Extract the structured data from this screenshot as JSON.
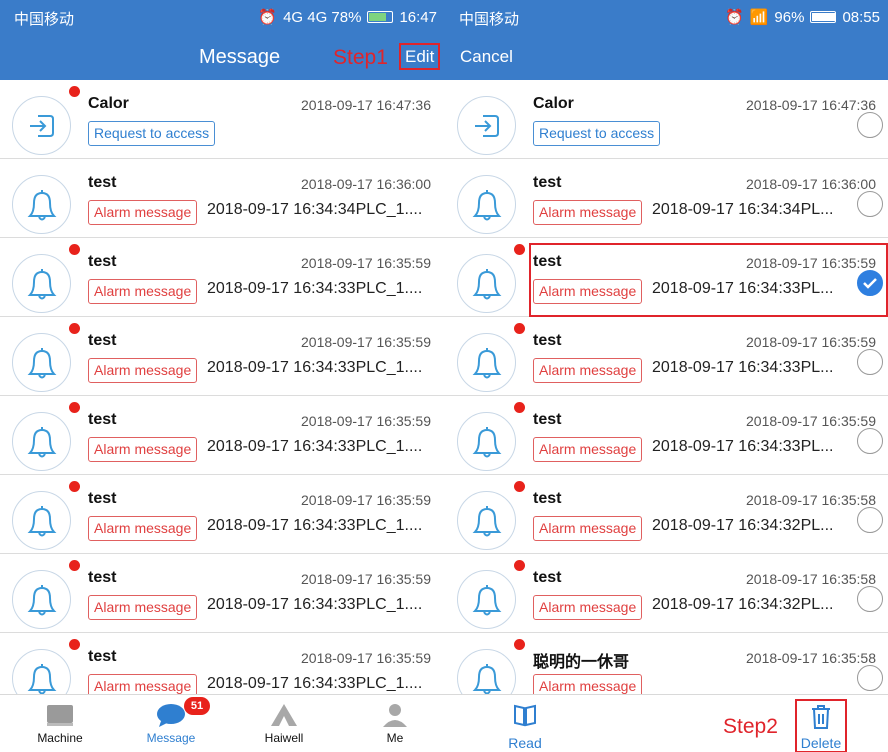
{
  "left": {
    "status": {
      "carrier": "中国移动",
      "info": "4G 4G 78%",
      "time": "16:47"
    },
    "nav": {
      "title": "Message",
      "step_label": "Step1",
      "edit_label": "Edit"
    },
    "rows": [
      {
        "name": "Calor",
        "time": "2018-09-17 16:47:36",
        "tag": "Request to access",
        "msg": "",
        "icon": "login-arrow-icon"
      },
      {
        "name": "test",
        "time": "2018-09-17 16:36:00",
        "tag": "Alarm message",
        "msg": "2018-09-17 16:34:34PLC_1....",
        "icon": "bell-icon"
      },
      {
        "name": "test",
        "time": "2018-09-17 16:35:59",
        "tag": "Alarm message",
        "msg": "2018-09-17 16:34:33PLC_1....",
        "icon": "bell-icon"
      },
      {
        "name": "test",
        "time": "2018-09-17 16:35:59",
        "tag": "Alarm message",
        "msg": "2018-09-17 16:34:33PLC_1....",
        "icon": "bell-icon"
      },
      {
        "name": "test",
        "time": "2018-09-17 16:35:59",
        "tag": "Alarm message",
        "msg": "2018-09-17 16:34:33PLC_1....",
        "icon": "bell-icon"
      },
      {
        "name": "test",
        "time": "2018-09-17 16:35:59",
        "tag": "Alarm message",
        "msg": "2018-09-17 16:34:33PLC_1....",
        "icon": "bell-icon"
      },
      {
        "name": "test",
        "time": "2018-09-17 16:35:59",
        "tag": "Alarm message",
        "msg": "2018-09-17 16:34:33PLC_1....",
        "icon": "bell-icon"
      },
      {
        "name": "test",
        "time": "2018-09-17 16:35:59",
        "tag": "Alarm message",
        "msg": "2018-09-17 16:34:33PLC_1....",
        "icon": "bell-icon"
      }
    ],
    "tabs": [
      {
        "label": "Machine",
        "icon": "machine-icon"
      },
      {
        "label": "Message",
        "icon": "chat-bubble-icon",
        "badge": "51"
      },
      {
        "label": "Haiwell",
        "icon": "haiwell-logo-icon"
      },
      {
        "label": "Me",
        "icon": "person-icon"
      }
    ]
  },
  "right": {
    "status": {
      "carrier": "中国移动",
      "info": "96%",
      "time": "08:55"
    },
    "nav": {
      "cancel_label": "Cancel"
    },
    "rows": [
      {
        "name": "Calor",
        "time": "2018-09-17 16:47:36",
        "tag": "Request to access",
        "msg": "",
        "checked": false,
        "icon": "login-arrow-icon"
      },
      {
        "name": "test",
        "time": "2018-09-17 16:36:00",
        "tag": "Alarm message",
        "msg": "2018-09-17 16:34:34PL...",
        "checked": false,
        "icon": "bell-icon"
      },
      {
        "name": "test",
        "time": "2018-09-17 16:35:59",
        "tag": "Alarm message",
        "msg": "2018-09-17 16:34:33PL...",
        "checked": true,
        "icon": "bell-icon"
      },
      {
        "name": "test",
        "time": "2018-09-17 16:35:59",
        "tag": "Alarm message",
        "msg": "2018-09-17 16:34:33PL...",
        "checked": false,
        "icon": "bell-icon"
      },
      {
        "name": "test",
        "time": "2018-09-17 16:35:59",
        "tag": "Alarm message",
        "msg": "2018-09-17 16:34:33PL...",
        "checked": false,
        "icon": "bell-icon"
      },
      {
        "name": "test",
        "time": "2018-09-17 16:35:58",
        "tag": "Alarm message",
        "msg": "2018-09-17 16:34:32PL...",
        "checked": false,
        "icon": "bell-icon"
      },
      {
        "name": "test",
        "time": "2018-09-17 16:35:58",
        "tag": "Alarm message",
        "msg": "2018-09-17 16:34:32PL...",
        "checked": false,
        "icon": "bell-icon"
      },
      {
        "name": "聪明的一休哥",
        "time": "2018-09-17 16:35:58",
        "tag": "Alarm message",
        "msg": "",
        "checked": false,
        "icon": "bell-icon"
      }
    ],
    "actions": {
      "read_label": "Read",
      "step_label": "Step2",
      "delete_label": "Delete"
    }
  },
  "colors": {
    "header": "#3a7cc9",
    "alarm": "#e04040",
    "request": "#2f7fd0",
    "highlight": "#e0242b",
    "badge": "#e8221b"
  }
}
